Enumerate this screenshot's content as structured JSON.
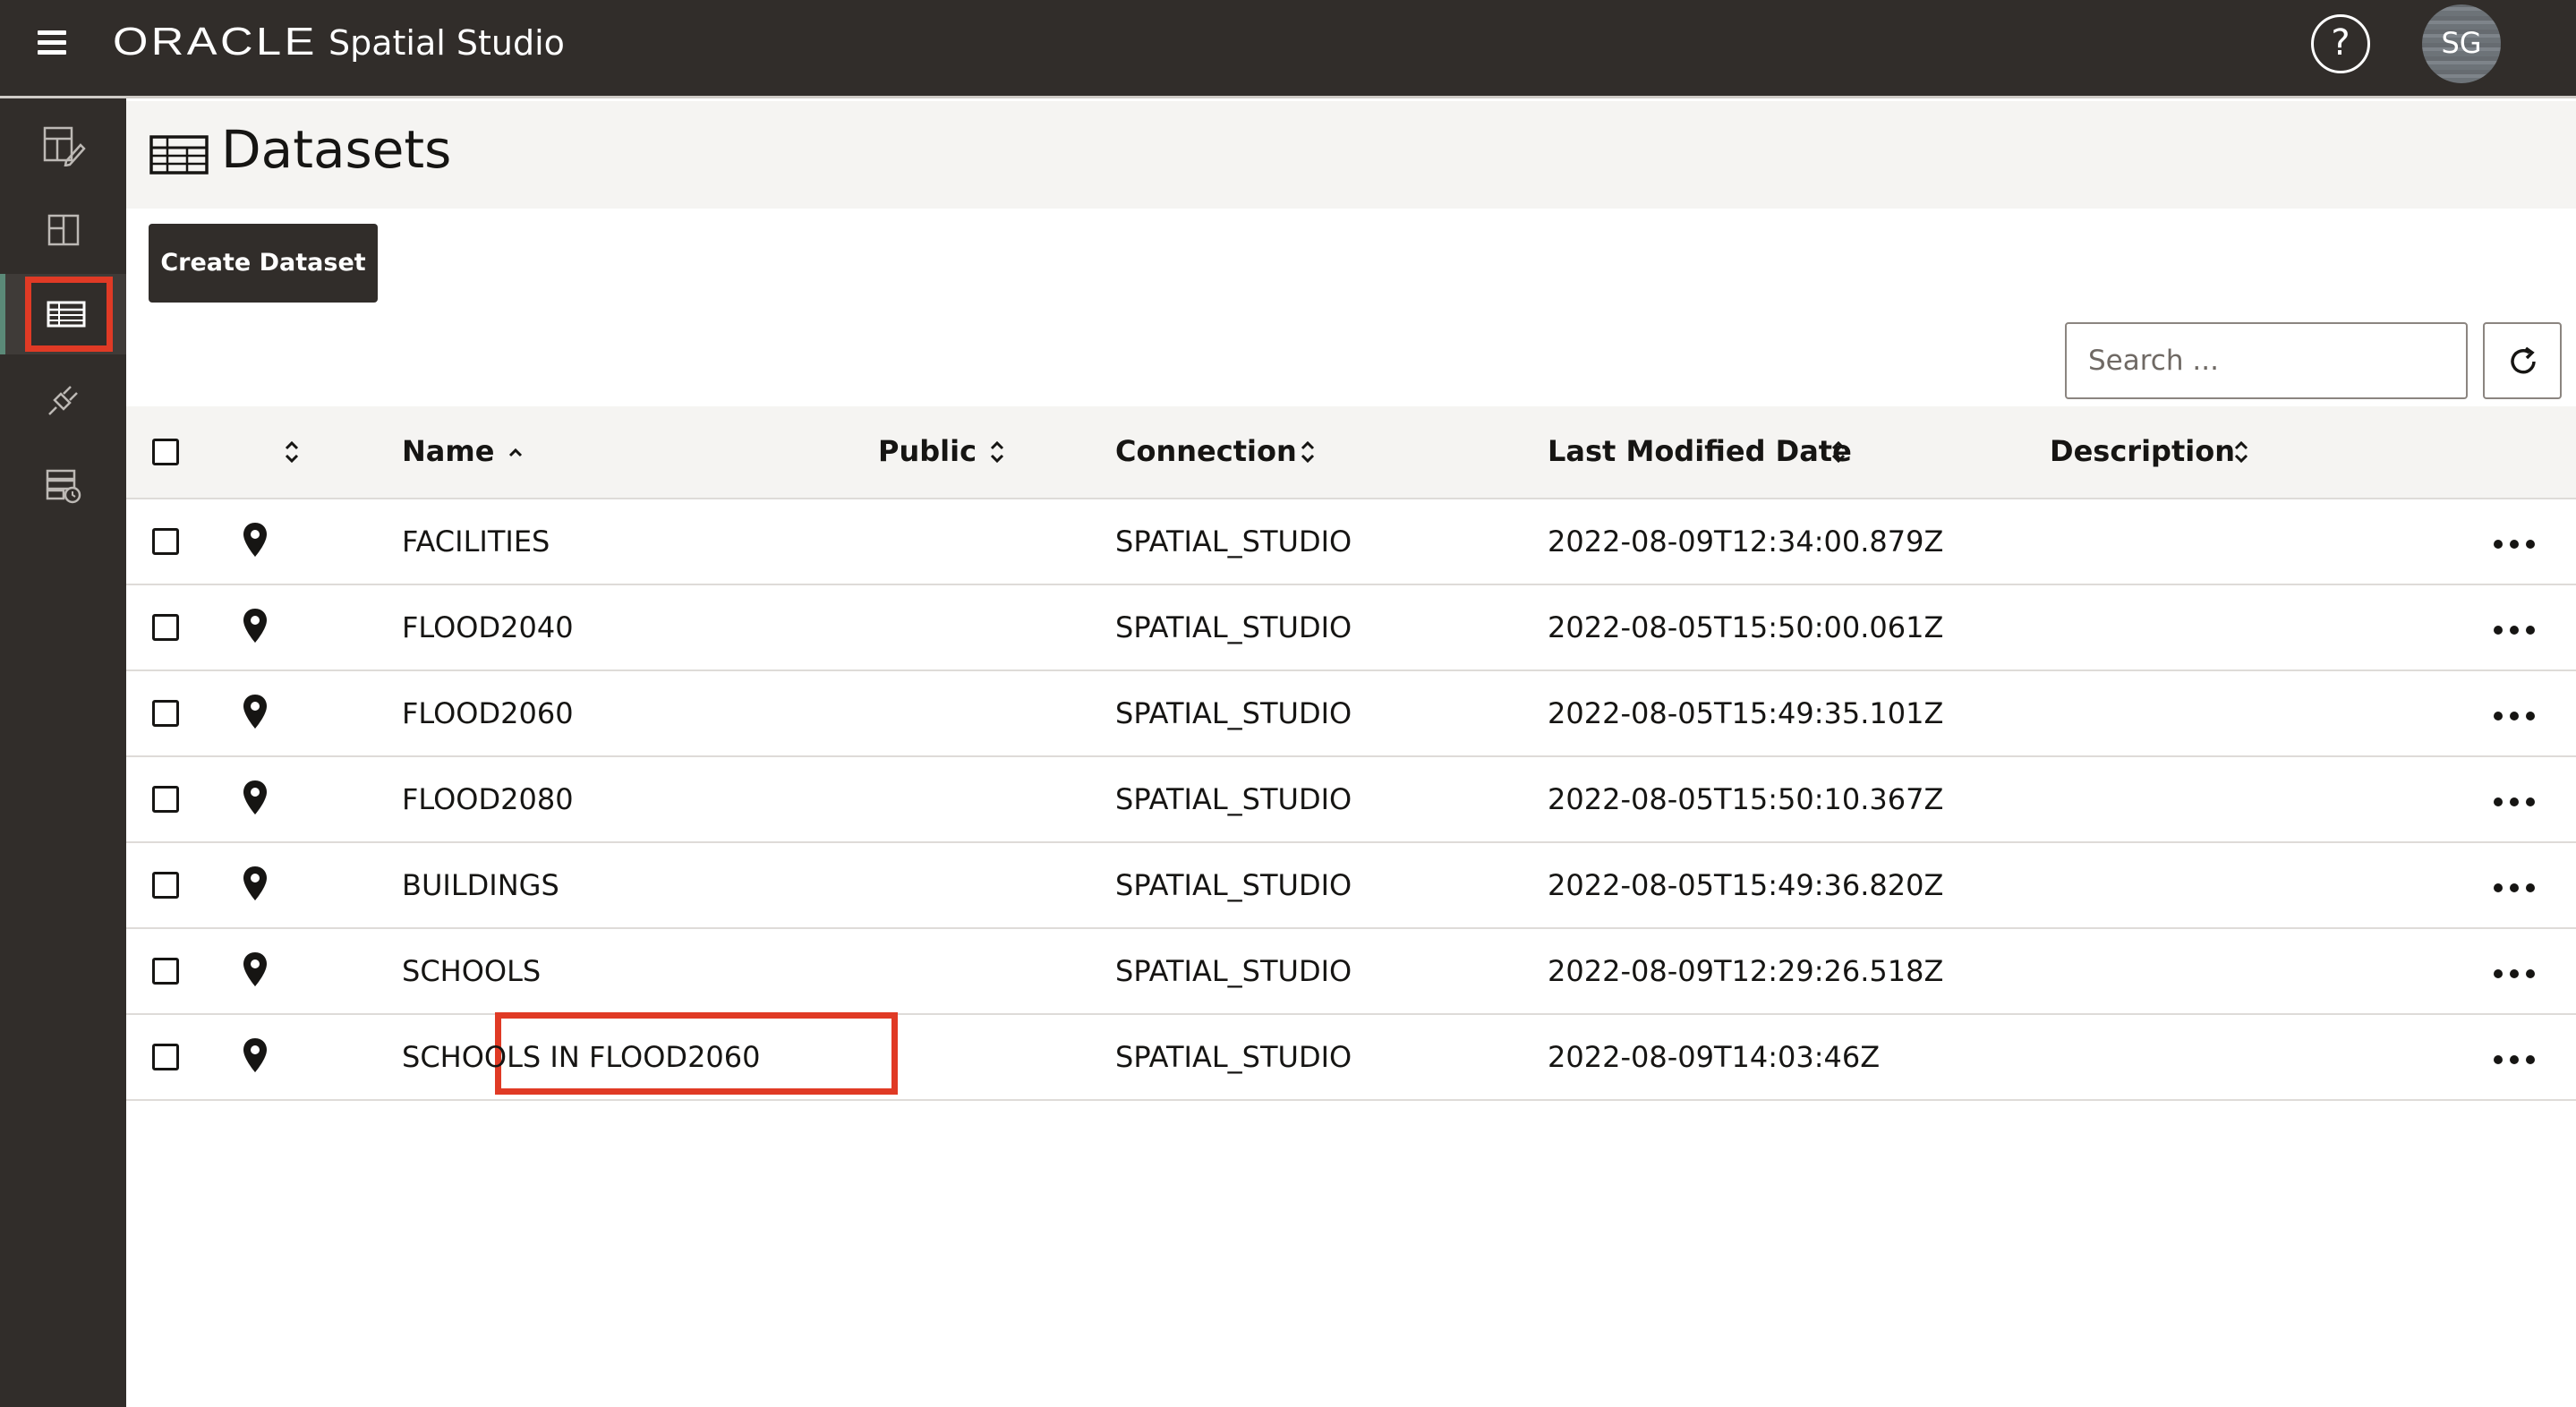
{
  "header": {
    "brand": "ORACLE",
    "product": "Spatial Studio",
    "help_glyph": "?",
    "avatar_initials": "SG"
  },
  "sidebar": {
    "items": [
      {
        "name": "projects",
        "icon": "project-edit-icon",
        "active": false
      },
      {
        "name": "layouts",
        "icon": "layout-icon",
        "active": false
      },
      {
        "name": "datasets",
        "icon": "table-icon",
        "active": true
      },
      {
        "name": "connections",
        "icon": "plug-icon",
        "active": false
      },
      {
        "name": "jobs",
        "icon": "server-clock-icon",
        "active": false
      }
    ]
  },
  "page": {
    "title": "Datasets",
    "create_button": "Create Dataset"
  },
  "search": {
    "placeholder": "Search ..."
  },
  "table": {
    "columns": {
      "name": "Name",
      "public": "Public",
      "connection": "Connection",
      "modified": "Last Modified Date",
      "description": "Description"
    },
    "rows": [
      {
        "name": "FACILITIES",
        "public": "",
        "connection": "SPATIAL_STUDIO",
        "modified": "2022-08-09T12:34:00.879Z",
        "description": ""
      },
      {
        "name": "FLOOD2040",
        "public": "",
        "connection": "SPATIAL_STUDIO",
        "modified": "2022-08-05T15:50:00.061Z",
        "description": ""
      },
      {
        "name": "FLOOD2060",
        "public": "",
        "connection": "SPATIAL_STUDIO",
        "modified": "2022-08-05T15:49:35.101Z",
        "description": ""
      },
      {
        "name": "FLOOD2080",
        "public": "",
        "connection": "SPATIAL_STUDIO",
        "modified": "2022-08-05T15:50:10.367Z",
        "description": ""
      },
      {
        "name": "BUILDINGS",
        "public": "",
        "connection": "SPATIAL_STUDIO",
        "modified": "2022-08-05T15:49:36.820Z",
        "description": ""
      },
      {
        "name": "SCHOOLS",
        "public": "",
        "connection": "SPATIAL_STUDIO",
        "modified": "2022-08-09T12:29:26.518Z",
        "description": ""
      },
      {
        "name": "SCHOOLS IN FLOOD2060",
        "public": "",
        "connection": "SPATIAL_STUDIO",
        "modified": "2022-08-09T14:03:46Z",
        "description": "",
        "highlighted": true
      }
    ]
  },
  "colors": {
    "header_bg": "#312d2a",
    "highlight": "#e03a25",
    "active_rail_accent": "#5b8a78"
  }
}
